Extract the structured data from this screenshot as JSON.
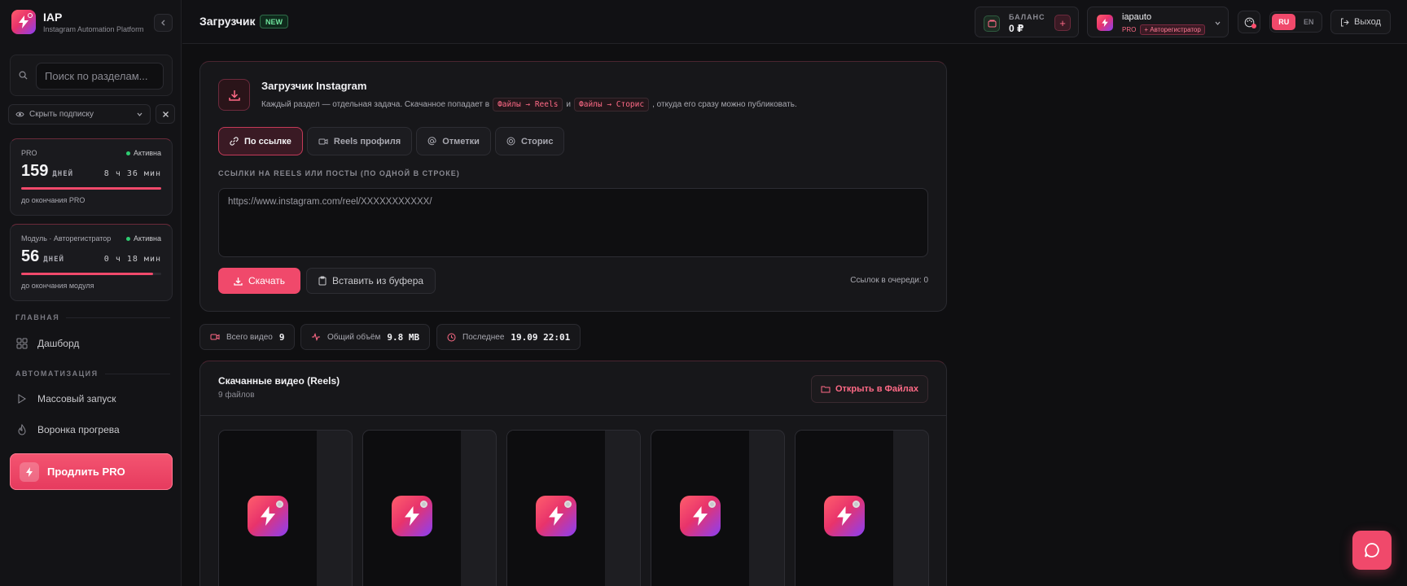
{
  "brand": {
    "title": "IAP",
    "subtitle": "Instagram Automation Platform"
  },
  "sidebar": {
    "search_placeholder": "Поиск по разделам...",
    "hide_subscription": "Скрыть подписку",
    "subscriptions": [
      {
        "label": "PRO",
        "status": "Активна",
        "days": "159",
        "days_unit": "ДНЕЙ",
        "time": "8 ч 36 мин",
        "progress": 1.0,
        "footer": "до окончания PRO"
      },
      {
        "label": "Модуль · Авторегистратор",
        "status": "Активна",
        "days": "56",
        "days_unit": "ДНЕЙ",
        "time": "0 ч 18 мин",
        "progress": 0.94,
        "footer": "до окончания модуля"
      }
    ],
    "sections": [
      {
        "title": "ГЛАВНАЯ",
        "items": [
          {
            "label": "Дашборд",
            "icon": "grid-icon"
          }
        ]
      },
      {
        "title": "АВТОМАТИЗАЦИЯ",
        "items": [
          {
            "label": "Массовый запуск",
            "icon": "play-icon"
          },
          {
            "label": "Воронка прогрева",
            "icon": "flame-icon"
          }
        ]
      }
    ],
    "promo": {
      "label": "Продлить PRO"
    }
  },
  "topbar": {
    "title": "Загрузчик",
    "badge": "NEW",
    "balance_label": "БАЛАНС",
    "balance_value": "0 ₽",
    "balance_add": "+",
    "username": "iapauto",
    "tier": "PRO",
    "tier_tag": "+ Авторегистратор",
    "lang_active": "RU",
    "lang_other": "EN",
    "logout": "Выход"
  },
  "downloader": {
    "title": "Загрузчик Instagram",
    "desc_before": "Каждый раздел — отдельная задача. Скачанное попадает в",
    "chip_reels": "Файлы → Reels",
    "desc_and": "и",
    "chip_stories": "Файлы → Сторис",
    "desc_after": ", откуда его сразу можно публиковать.",
    "tabs": [
      {
        "label": "По ссылке",
        "icon": "link-icon",
        "active": true
      },
      {
        "label": "Reels профиля",
        "icon": "video-icon",
        "active": false
      },
      {
        "label": "Отметки",
        "icon": "at-icon",
        "active": false
      },
      {
        "label": "Сторис",
        "icon": "circle-icon",
        "active": false
      }
    ],
    "field_label": "ССЫЛКИ НА REELS ИЛИ ПОСТЫ (ПО ОДНОЙ В СТРОКЕ)",
    "field_placeholder": "https://www.instagram.com/reel/XXXXXXXXXXX/",
    "download_btn": "Скачать",
    "paste_btn": "Вставить из буфера",
    "queue": "Ссылок в очереди: 0"
  },
  "stats": [
    {
      "label": "Всего видео",
      "value": "9"
    },
    {
      "label": "Общий объём",
      "value": "9.8 MB"
    },
    {
      "label": "Последнее",
      "value": "19.09 22:01"
    }
  ],
  "videos": {
    "title": "Скачанные видео (Reels)",
    "count": "9 файлов",
    "open_btn": "Открыть в Файлах"
  },
  "colors": {
    "accent": "#f0496b",
    "success": "#2ecc71",
    "background": "#0f0f11"
  }
}
